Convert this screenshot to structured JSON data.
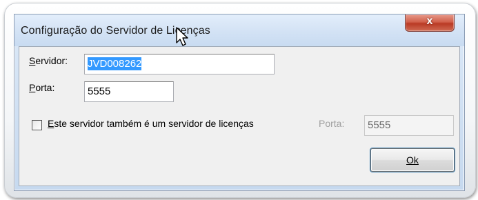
{
  "window": {
    "title": "Configuração do Servidor de Licenças",
    "close_label": "x"
  },
  "form": {
    "server": {
      "label": "Servidor:",
      "value": "JVD008262"
    },
    "port": {
      "label": "Porta:",
      "value": "5555"
    },
    "license_server_checkbox": {
      "label": "Este servidor também é um servidor de licenças",
      "checked": false
    },
    "license_port": {
      "label": "Porta:",
      "value": "5555"
    }
  },
  "buttons": {
    "ok_label": "Ok"
  },
  "icons": {
    "close": "close-icon",
    "cursor": "mouse-cursor-icon"
  }
}
